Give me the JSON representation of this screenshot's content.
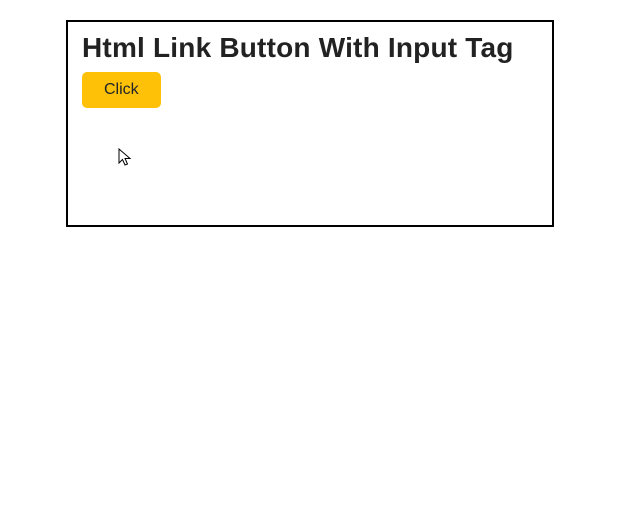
{
  "heading": "Html Link Button With Input Tag",
  "button": {
    "label": "Click"
  }
}
